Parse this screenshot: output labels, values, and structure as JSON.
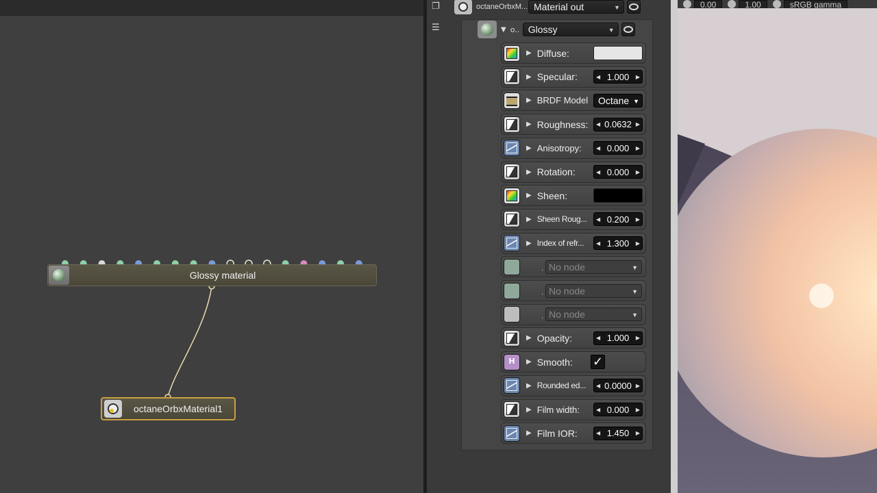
{
  "graph": {
    "glossy_node_title": "Glossy material",
    "output_node_title": "octaneOrbxMaterial1",
    "pin_colors": [
      "#8ecfa6",
      "#8ecfa6",
      "#d8d8d8",
      "#8ecfa6",
      "#7a9ad8",
      "#8ecfa6",
      "#8ecfa6",
      "#8ecfa6",
      "#7a9ad8",
      "hollow",
      "hollow",
      "hollow",
      "#8ecfa6",
      "#d888c0",
      "#7a9ad8",
      "#8ecfa6",
      "#7a9ad8"
    ]
  },
  "inspector": {
    "material_out_name": "octaneOrbxM...",
    "material_out_select": "Material out",
    "glossy_short_name": "o...",
    "glossy_select": "Glossy",
    "rows": [
      {
        "label": "Diffuse:",
        "icon": "rgb-texture-icon",
        "type": "color",
        "value": "#e6e6e6"
      },
      {
        "label": "Specular:",
        "icon": "float-texture-icon",
        "type": "number",
        "value": "1.000"
      },
      {
        "label": "BRDF Model:",
        "icon": "enum-icon",
        "type": "enum",
        "value": "Octane"
      },
      {
        "label": "Roughness:",
        "icon": "float-texture-icon",
        "type": "number",
        "value": "0.0632"
      },
      {
        "label": "Anisotropy:",
        "icon": "curve-icon",
        "type": "number",
        "value": "0.000"
      },
      {
        "label": "Rotation:",
        "icon": "float-texture-icon",
        "type": "number",
        "value": "0.000"
      },
      {
        "label": "Sheen:",
        "icon": "rgb-texture-icon",
        "type": "color",
        "value": "#000000"
      },
      {
        "label": "Sheen Roug...",
        "icon": "float-texture-icon",
        "type": "number",
        "value": "0.200"
      },
      {
        "label": "Index of refr...",
        "icon": "curve-icon",
        "type": "number",
        "value": "1.300"
      },
      {
        "label": "",
        "icon": "green-pin-icon",
        "type": "nonode",
        "value": "No node"
      },
      {
        "label": "",
        "icon": "green-pin-icon",
        "type": "nonode",
        "value": "No node"
      },
      {
        "label": "",
        "icon": "grey-pin-icon",
        "type": "nonode",
        "value": "No node"
      },
      {
        "label": "Opacity:",
        "icon": "float-texture-icon",
        "type": "number",
        "value": "1.000"
      },
      {
        "label": "Smooth:",
        "icon": "bool-icon",
        "type": "check",
        "value": "✓"
      },
      {
        "label": "Rounded ed...",
        "icon": "curve-icon",
        "type": "number",
        "value": "0.0000"
      },
      {
        "label": "Film width:",
        "icon": "float-texture-icon",
        "type": "number",
        "value": "0.000"
      },
      {
        "label": "Film IOR:",
        "icon": "curve-icon",
        "type": "number",
        "value": "1.450"
      }
    ]
  },
  "viewport": {
    "field1": "0.00",
    "field2": "1.00",
    "colorspace": "sRGB gamma"
  }
}
